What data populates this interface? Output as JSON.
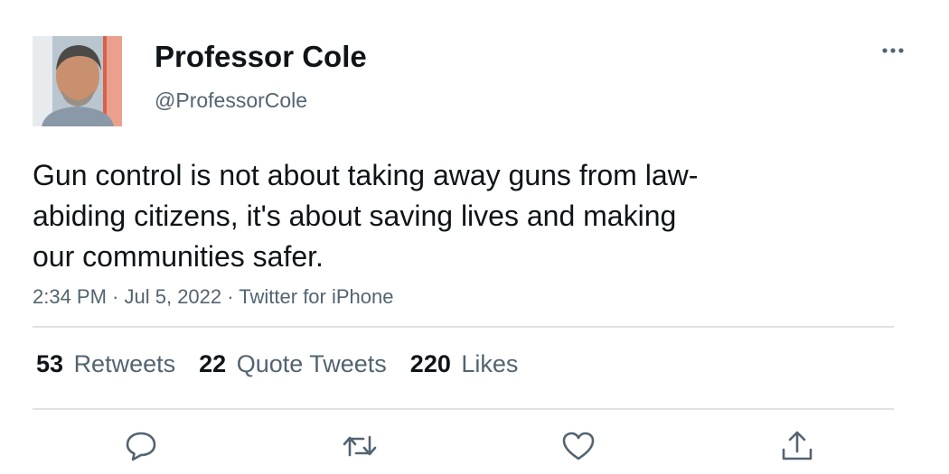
{
  "author": {
    "display_name": "Professor Cole",
    "handle": "@ProfessorCole"
  },
  "tweet": {
    "text_lines": [
      "Gun control is not about taking away guns from law-",
      "abiding citizens, it's about saving lives and making",
      "our communities safer."
    ]
  },
  "meta": {
    "time": "2:34 PM",
    "sep1": " · ",
    "date": "Jul 5, 2022",
    "sep2": " · ",
    "source": "Twitter for iPhone"
  },
  "stats": {
    "retweets": {
      "count": "53",
      "label": "Retweets"
    },
    "quotes": {
      "count": "22",
      "label": "Quote Tweets"
    },
    "likes": {
      "count": "220",
      "label": "Likes"
    }
  },
  "icons": {
    "more": "more-horizontal-icon",
    "reply": "reply-icon",
    "retweet": "retweet-icon",
    "like": "heart-icon",
    "share": "share-icon"
  },
  "colors": {
    "text": "#0f1419",
    "secondary": "#536471",
    "divider": "#dfe3e6"
  }
}
